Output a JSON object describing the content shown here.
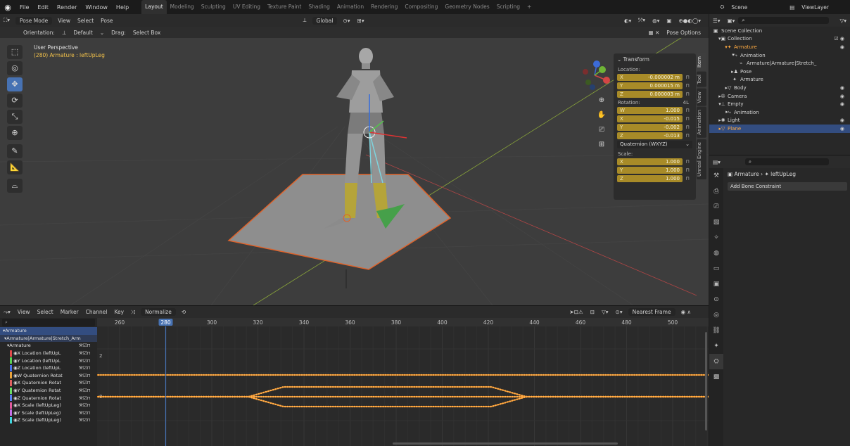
{
  "topbar": {
    "menus": [
      "File",
      "Edit",
      "Render",
      "Window",
      "Help"
    ],
    "workspaces": [
      "Layout",
      "Modeling",
      "Sculpting",
      "UV Editing",
      "Texture Paint",
      "Shading",
      "Animation",
      "Rendering",
      "Compositing",
      "Geometry Nodes",
      "Scripting"
    ],
    "active_workspace": "Layout",
    "scene": "Scene",
    "view_layer": "ViewLayer"
  },
  "viewport": {
    "mode": "Pose Mode",
    "menus": [
      "View",
      "Select",
      "Pose"
    ],
    "orientation_label": "Orientation:",
    "orientation_value": "Default",
    "drag_label": "Drag:",
    "drag_value": "Select Box",
    "transform_orientation": "Global",
    "pose_options": "Pose Options",
    "info_title": "User Perspective",
    "info_object": "(280) Armature : leftUpLeg",
    "side_tabs": [
      "Item",
      "Tool",
      "View",
      "Animation",
      "Unreal Engine"
    ]
  },
  "transform_panel": {
    "title": "Transform",
    "location_label": "Location:",
    "location": [
      {
        "axis": "X",
        "value": "-0.000002 m"
      },
      {
        "axis": "Y",
        "value": "0.000015 m"
      },
      {
        "axis": "Z",
        "value": "0.000003 m"
      }
    ],
    "rotation_label": "Rotation:",
    "rotation_mode_tag": "4L",
    "rotation": [
      {
        "axis": "W",
        "value": "1.000"
      },
      {
        "axis": "X",
        "value": "-0.015"
      },
      {
        "axis": "Y",
        "value": "-0.002"
      },
      {
        "axis": "Z",
        "value": "-0.013"
      }
    ],
    "rotation_mode": "Quaternion (WXYZ)",
    "scale_label": "Scale:",
    "scale": [
      {
        "axis": "X",
        "value": "1.000"
      },
      {
        "axis": "Y",
        "value": "1.000"
      },
      {
        "axis": "Z",
        "value": "1.000"
      }
    ]
  },
  "outliner": {
    "rows": [
      {
        "label": "Scene Collection",
        "indent": 0,
        "icon": "▣"
      },
      {
        "label": "Collection",
        "indent": 1,
        "icon": "▾▣",
        "right": "☑ ◉"
      },
      {
        "label": "Armature",
        "indent": 2,
        "icon": "▾✦",
        "right": "◉",
        "highlight": true
      },
      {
        "label": "Animation",
        "indent": 3,
        "icon": "▾⤷"
      },
      {
        "label": "Armature|Armature|Stretch_",
        "indent": 4,
        "icon": "⌁"
      },
      {
        "label": "Pose",
        "indent": 3,
        "icon": "▸♟"
      },
      {
        "label": "Armature",
        "indent": 3,
        "icon": "✦"
      },
      {
        "label": "Body",
        "indent": 2,
        "icon": "▸▽",
        "right": "◉"
      },
      {
        "label": "Camera",
        "indent": 1,
        "icon": "▸✇",
        "right": "◉"
      },
      {
        "label": "Empty",
        "indent": 1,
        "icon": "▾⊥",
        "right": "◉"
      },
      {
        "label": "Animation",
        "indent": 2,
        "icon": "▸⤷"
      },
      {
        "label": "Light",
        "indent": 1,
        "icon": "▸✺",
        "right": "◉"
      },
      {
        "label": "Plane",
        "indent": 1,
        "icon": "▸▽",
        "right": "◉",
        "selected": true
      }
    ]
  },
  "properties": {
    "breadcrumb_object": "Armature",
    "breadcrumb_bone": "leftUpLeg",
    "add_constraint": "Add Bone Constraint"
  },
  "graph_editor": {
    "menus": [
      "View",
      "Select",
      "Marker",
      "Channel",
      "Key"
    ],
    "normalize": "Normalize",
    "snap": "Nearest Frame",
    "ruler_frames": [
      "260",
      "280",
      "300",
      "320",
      "340",
      "360",
      "380",
      "400",
      "420",
      "440",
      "460",
      "480",
      "500"
    ],
    "current_frame": "280",
    "y_label_2": "2",
    "y_label_0": "0",
    "channels": [
      {
        "label": "Armature",
        "kind": "object",
        "color": "#4d76c2"
      },
      {
        "label": "Armature|Armature|Stretch_Arm",
        "kind": "action",
        "color": "#4d76c2"
      },
      {
        "label": "Armature",
        "kind": "group",
        "color": "#4d76c2"
      },
      {
        "label": "X Location (leftUpL",
        "kind": "fcurve",
        "color": "#e24b4b"
      },
      {
        "label": "Y Location (leftUpL",
        "kind": "fcurve",
        "color": "#5ad454"
      },
      {
        "label": "Z Location (leftUpL",
        "kind": "fcurve",
        "color": "#4a72e8"
      },
      {
        "label": "W Quaternion Rotat",
        "kind": "fcurve",
        "color": "#e8a33b"
      },
      {
        "label": "X Quaternion Rotat",
        "kind": "fcurve",
        "color": "#e06060"
      },
      {
        "label": "Y Quaternion Rotat",
        "kind": "fcurve",
        "color": "#6adf64"
      },
      {
        "label": "Z Quaternion Rotat",
        "kind": "fcurve",
        "color": "#5b80f0"
      },
      {
        "label": "X Scale (leftUpLeg)",
        "kind": "fcurve",
        "color": "#e25a9e"
      },
      {
        "label": "Y Scale (leftUpLeg)",
        "kind": "fcurve",
        "color": "#c46ee8"
      },
      {
        "label": "Z Scale (leftUpLeg)",
        "kind": "fcurve",
        "color": "#3fd7e0"
      }
    ]
  },
  "colors": {
    "accent": "#4772b3",
    "curve": "#f08c1e",
    "field": "#a88b28",
    "selected_object": "#ffab42"
  }
}
